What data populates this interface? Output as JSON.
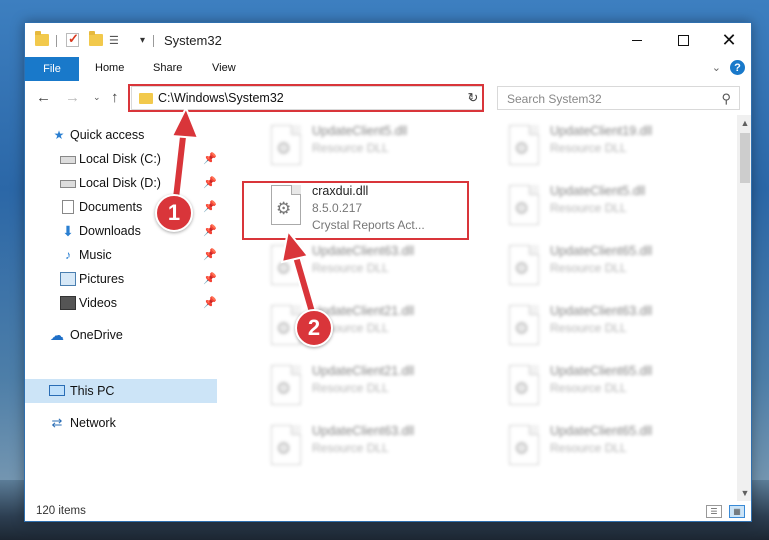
{
  "window": {
    "title": "System32",
    "minimize": "–",
    "maximize": "☐",
    "close": "✕"
  },
  "ribbon": {
    "tabs": [
      "File",
      "Home",
      "Share",
      "View"
    ],
    "help": "?",
    "collapse": "⌄"
  },
  "nav": {
    "back": "←",
    "forward": "→",
    "recent": "⌄",
    "up": "↑",
    "address": "C:\\Windows\\System32",
    "address_dropdown": "⌄",
    "refresh": "↻",
    "search_placeholder": "Search System32",
    "search_icon": "⚲"
  },
  "sidebar": {
    "items": [
      {
        "label": "Quick access",
        "icon": "star-icon",
        "glyph": "★",
        "pinned": false
      },
      {
        "label": "Local Disk (C:)",
        "icon": "drive-icon",
        "glyph": "",
        "pinned": true
      },
      {
        "label": "Local Disk (D:)",
        "icon": "drive-icon",
        "glyph": "",
        "pinned": true
      },
      {
        "label": "Documents",
        "icon": "document-icon",
        "glyph": "",
        "pinned": true
      },
      {
        "label": "Downloads",
        "icon": "download-arrow-icon",
        "glyph": "⬇",
        "pinned": true
      },
      {
        "label": "Music",
        "icon": "music-note-icon",
        "glyph": "♪",
        "pinned": true
      },
      {
        "label": "Pictures",
        "icon": "picture-icon",
        "glyph": "",
        "pinned": true
      },
      {
        "label": "Videos",
        "icon": "film-icon",
        "glyph": "",
        "pinned": true
      },
      {
        "label": "OneDrive",
        "icon": "cloud-icon",
        "glyph": "☁",
        "pinned": false
      },
      {
        "label": "This PC",
        "icon": "computer-icon",
        "glyph": "",
        "pinned": false,
        "selected": true
      },
      {
        "label": "Network",
        "icon": "network-icon",
        "glyph": "⇄",
        "pinned": false
      }
    ],
    "pin_glyph": "📌"
  },
  "files": {
    "left": [
      {
        "name": "UpdateClient5.dll",
        "desc": "Resource DLL",
        "blurred": true
      },
      {
        "name": "craxdui.dll",
        "desc": "8.5.0.217",
        "desc2": "Crystal Reports Act...",
        "blurred": false
      },
      {
        "name": "UpdateClient63.dll",
        "desc": "Resource DLL",
        "blurred": true
      },
      {
        "name": "UpdateClient21.dll",
        "desc": "Resource DLL",
        "blurred": true
      },
      {
        "name": "UpdateClient21.dll",
        "desc": "Resource DLL",
        "blurred": true
      },
      {
        "name": "UpdateClient63.dll",
        "desc": "Resource DLL",
        "blurred": true
      }
    ],
    "right": [
      {
        "name": "UpdateClient19.dll",
        "desc": "Resource DLL",
        "blurred": true
      },
      {
        "name": "UpdateClient5.dll",
        "desc": "Resource DLL",
        "blurred": true
      },
      {
        "name": "UpdateClient65.dll",
        "desc": "Resource DLL",
        "blurred": true
      },
      {
        "name": "UpdateClient63.dll",
        "desc": "Resource DLL",
        "blurred": true
      },
      {
        "name": "UpdateClient65.dll",
        "desc": "Resource DLL",
        "blurred": true
      },
      {
        "name": "UpdateClient65.dll",
        "desc": "Resource DLL",
        "blurred": true
      }
    ]
  },
  "status": {
    "item_count": "120 items"
  },
  "annotations": {
    "step1": "1",
    "step2": "2",
    "highlight_color": "#d9353a"
  }
}
